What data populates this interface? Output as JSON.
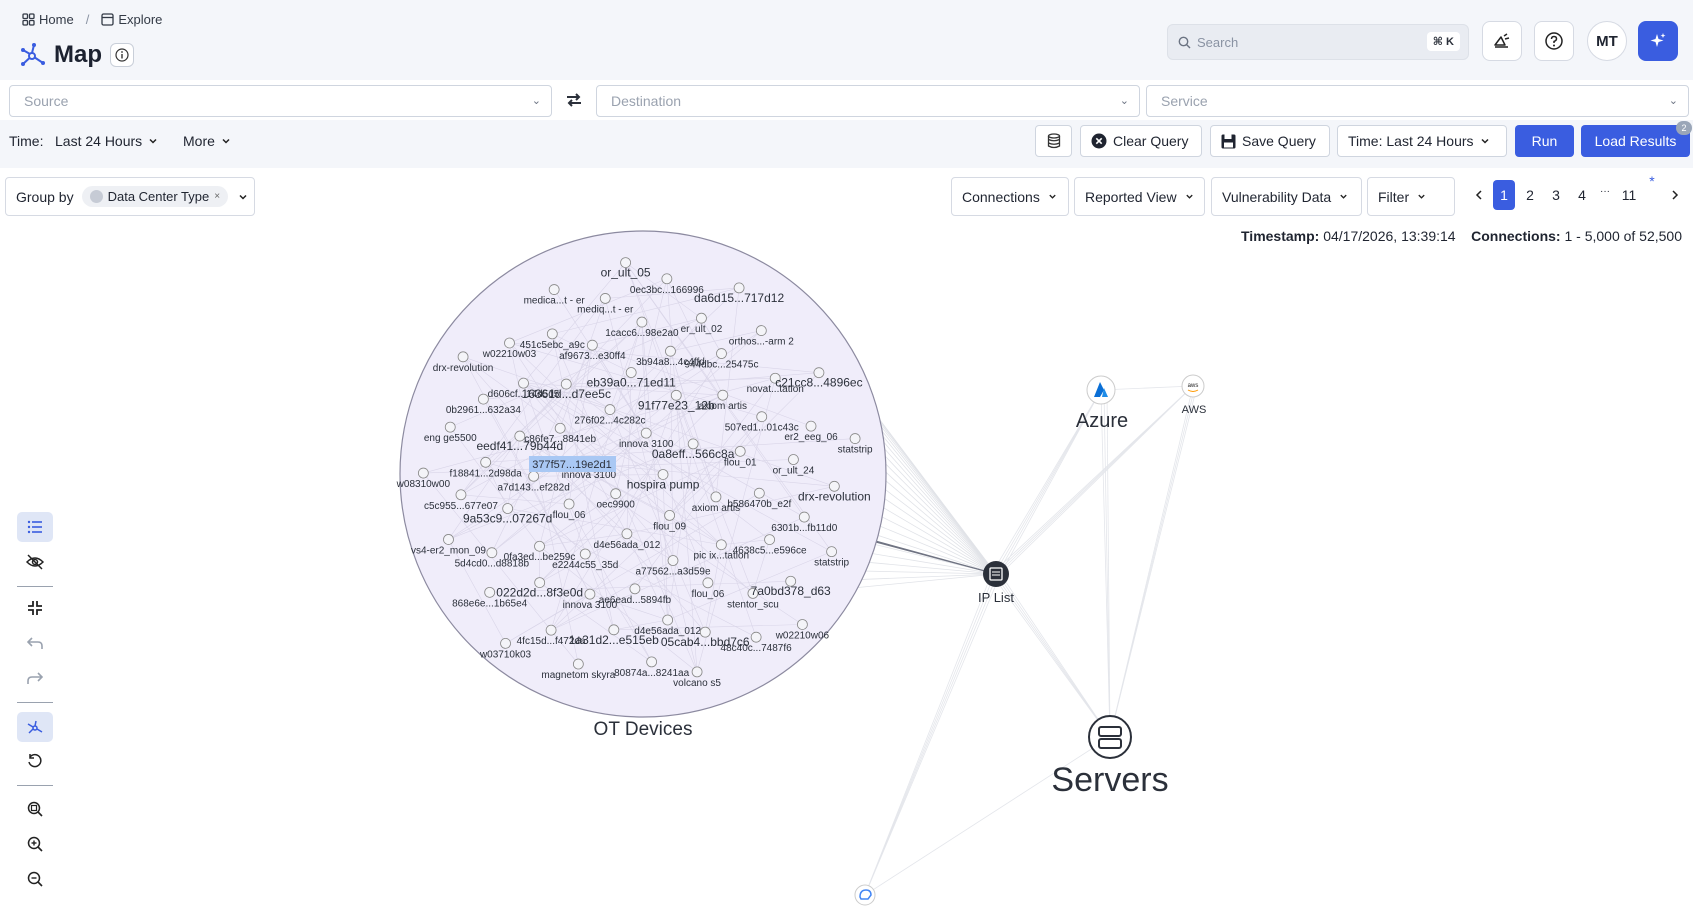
{
  "breadcrumb": {
    "home": "Home",
    "explore": "Explore"
  },
  "page": {
    "title": "Map"
  },
  "header": {
    "search_placeholder": "Search",
    "search_shortcut": "⌘ K",
    "avatar_initials": "MT"
  },
  "filters": {
    "source_placeholder": "Source",
    "destination_placeholder": "Destination",
    "service_placeholder": "Service"
  },
  "toolbar": {
    "time_label": "Time:",
    "time_value": "Last 24 Hours",
    "more_label": "More",
    "clear_query": "Clear Query",
    "save_query": "Save Query",
    "time_button": "Time: Last 24 Hours",
    "run": "Run",
    "load_results": "Load Results",
    "load_results_badge": "2"
  },
  "groupby": {
    "label": "Group by",
    "chip": "Data Center Type",
    "chip_remove": "×"
  },
  "view_controls": {
    "connections": "Connections",
    "reported_view": "Reported View",
    "vulnerability_data": "Vulnerability Data",
    "filter": "Filter"
  },
  "pagination": {
    "pages": [
      "1",
      "2",
      "3",
      "4",
      "11"
    ],
    "ellipsis": "···",
    "marker": "*",
    "current": "1"
  },
  "stats": {
    "timestamp_label": "Timestamp:",
    "timestamp_value": "04/17/2026, 13:39:14",
    "connections_label": "Connections:",
    "connections_value": "1 - 5,000 of 52,500"
  },
  "graph": {
    "cluster_label": "OT Devices",
    "hubs": {
      "azure": "Azure",
      "aws": "AWS",
      "ip_list": "IP List",
      "servers": "Servers"
    },
    "highlighted_node": "377f57...19e2d1",
    "device_labels": [
      "hospira pump",
      "oec9900",
      "innova 3100",
      "flou_09",
      "innova 3100",
      "0a8eff...566c8a",
      "d4e56ada_012",
      "276f02...4c282c",
      "axiom artis",
      "flou_06",
      "91f77e23_12b",
      "a77562...a3d59e",
      "c86fe7...8841eb",
      "flou_01",
      "e2244c55_35d",
      "eb39a0...71ed11",
      "pic ix...tation",
      "a7d143...ef282d",
      "axiom artis",
      "ae6ead...5894fb",
      "16361d...d7ee5c",
      "b586470b_e2f",
      "0fa3ed...be259c",
      "3b94a8...4c4ffd",
      "flou_06",
      "eedf41...79b44d",
      "507ed1...01c43c",
      "innova 3100",
      "af9673...e30ff4",
      "4638c5...e596ce",
      "9a53c9...07267d",
      "944dbc...25475c",
      "d4e56ada_012",
      "d606cf...14d5d5",
      "or_ult_24",
      "022d2d...8f3e0d",
      "1cacc6...98e2a0",
      "stentor_scu",
      "f18841...2d98da",
      "novat...tation",
      "1a31d2...e515eb",
      "451c5ebc_a9c",
      "6301b...fb11d0",
      "5d4cd0...d8818b",
      "er_ult_02",
      "05cab4...bbd7c6",
      "0b2961...632a34",
      "er2_eeg_06",
      "4fc15d...f472da",
      "mediq...t - er",
      "7a0bd378_d63",
      "c5c955...677e07",
      "orthos...-arm 2",
      "80874a...8241aa",
      "w02210w03",
      "drx-revolution",
      "868e6e...1b65e4",
      "0ec3bc...166996",
      "48c40c...7487f6",
      "eng ge5500",
      "c21cc8...4896ec",
      "magnetom skyra",
      "medica...t - er",
      "statstrip",
      "vs4-er2_mon_09",
      "da6d15...717d12",
      "volcano s5",
      "drx-revolution",
      "statstrip",
      "w03710k03",
      "or_ult_05",
      "w02210w06",
      "w08310w00"
    ]
  }
}
